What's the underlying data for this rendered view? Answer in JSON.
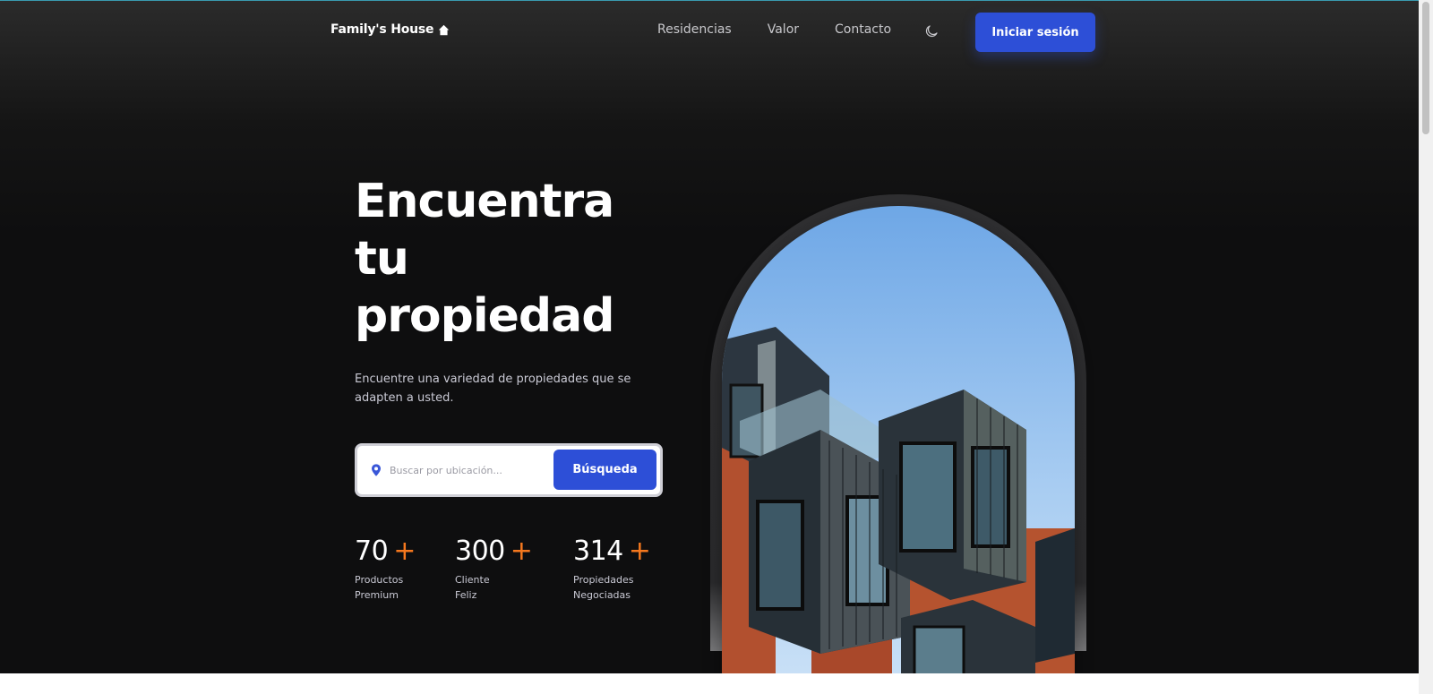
{
  "header": {
    "logo_text": "Family's House",
    "logo_icon": "home-icon",
    "nav": [
      "Residencias",
      "Valor",
      "Contacto"
    ],
    "theme_icon": "moon-icon",
    "login_label": "Iniciar sesión"
  },
  "hero": {
    "title_lines": [
      "Encuentra",
      "tu",
      "propiedad"
    ],
    "subtitle": "Encuentre una variedad de propiedades que se adapten a usted.",
    "search": {
      "placeholder": "Buscar por ubicación...",
      "icon": "location-pin-icon",
      "button_label": "Búsqueda"
    },
    "stats": [
      {
        "value": "70",
        "plus": "+",
        "label_line1": "Productos",
        "label_line2": "Premium"
      },
      {
        "value": "300",
        "plus": "+",
        "label_line1": "Cliente",
        "label_line2": "Feliz"
      },
      {
        "value": "314",
        "plus": "+",
        "label_line1": "Propiedades",
        "label_line2": "Negociadas"
      }
    ]
  },
  "colors": {
    "accent": "#2d4fd7",
    "plus": "#f5781e",
    "background": "#0e0e0f"
  }
}
